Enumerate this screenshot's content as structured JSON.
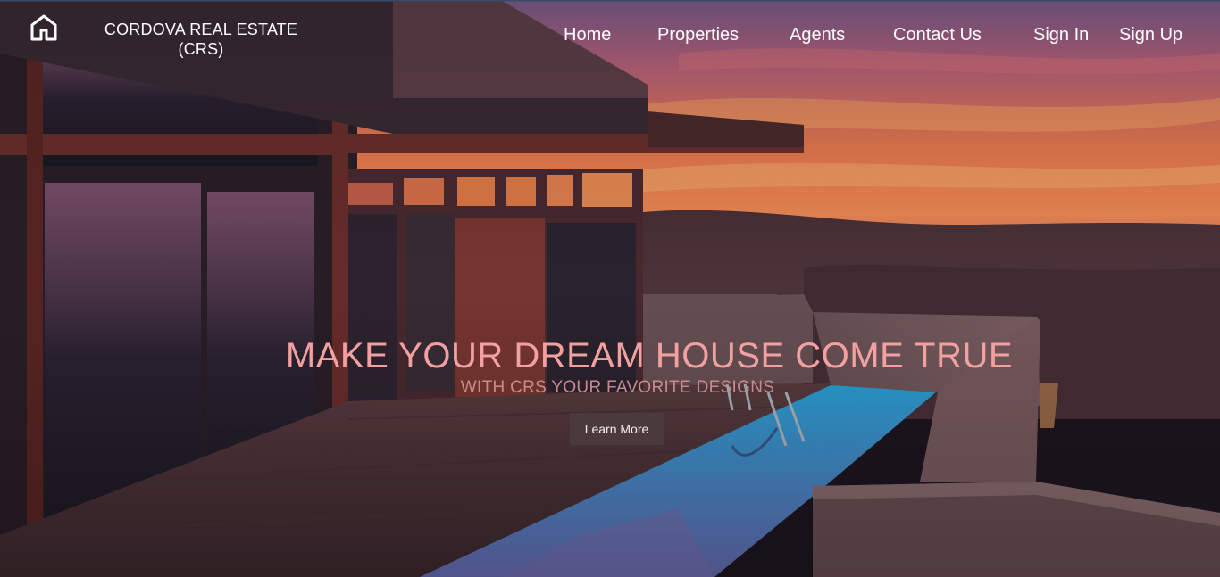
{
  "header": {
    "logo_icon": "home-icon",
    "brand_line1": "CORDOVA REAL ESTATE",
    "brand_line2": "(CRS)"
  },
  "nav": {
    "home": "Home",
    "properties": "Properties",
    "agents": "Agents",
    "contact": "Contact Us",
    "sign_in": "Sign In",
    "sign_up": "Sign Up"
  },
  "hero": {
    "title": "MAKE YOUR DREAM HOUSE COME TRUE",
    "subtitle": "WITH CRS YOUR FAVORITE DESIGNS",
    "cta": "Learn More"
  },
  "colors": {
    "title": "#f2a0a0",
    "subtitle": "#c98a8f",
    "button_bg": "#4b3a3c",
    "pool": "#2a9bd6"
  }
}
